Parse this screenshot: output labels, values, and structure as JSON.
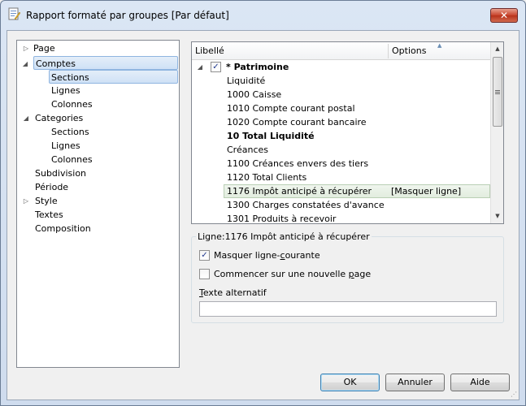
{
  "window": {
    "title": "Rapport formaté par groupes [Par défaut]",
    "close_glyph": "✕"
  },
  "tree": {
    "items": [
      {
        "label": "Page",
        "arrow": "▷"
      },
      {
        "label": "Comptes",
        "arrow": "◢"
      },
      {
        "label": "Sections",
        "arrow": ""
      },
      {
        "label": "Lignes",
        "arrow": ""
      },
      {
        "label": "Colonnes",
        "arrow": ""
      },
      {
        "label": "Categories",
        "arrow": "◢"
      },
      {
        "label": "Sections",
        "arrow": ""
      },
      {
        "label": "Lignes",
        "arrow": ""
      },
      {
        "label": "Colonnes",
        "arrow": ""
      },
      {
        "label": "Subdivision",
        "arrow": ""
      },
      {
        "label": "Période",
        "arrow": ""
      },
      {
        "label": "Style",
        "arrow": "▷"
      },
      {
        "label": "Textes",
        "arrow": ""
      },
      {
        "label": "Composition",
        "arrow": ""
      }
    ]
  },
  "list": {
    "col_libelle": "Libellé",
    "col_options": "Options",
    "sort_glyph": "▲",
    "root_arrow": "◢",
    "rows": [
      {
        "label": "* Patrimoine",
        "options": "",
        "checked": "✓"
      },
      {
        "label": "Liquidité",
        "options": ""
      },
      {
        "label": "1000 Caisse",
        "options": ""
      },
      {
        "label": "1010 Compte courant postal",
        "options": ""
      },
      {
        "label": "1020 Compte courant bancaire",
        "options": ""
      },
      {
        "label": "10 Total Liquidité",
        "options": ""
      },
      {
        "label": "Créances",
        "options": ""
      },
      {
        "label": "1100 Créances envers des tiers",
        "options": ""
      },
      {
        "label": "1120 Total Clients",
        "options": ""
      },
      {
        "label": "1176 Impôt anticipé à récupérer",
        "options": "[Masquer ligne]"
      },
      {
        "label": "1300 Charges constatées d'avance",
        "options": ""
      },
      {
        "label": "1301 Produits à recevoir",
        "options": ""
      }
    ],
    "scroll_up": "▲",
    "scroll_down": "▼"
  },
  "line_group": {
    "legend": "Ligne:1176 Impôt anticipé à récupérer",
    "hide_line": {
      "before": "Masquer ligne-",
      "underlined": "c",
      "after": "ourante",
      "checked": "✓"
    },
    "new_page": {
      "before": "Commencer sur une nouvelle ",
      "underlined": "p",
      "after": "age",
      "checked": ""
    },
    "alt_text": {
      "underlined": "T",
      "after": "exte alternatif",
      "value": ""
    }
  },
  "buttons": {
    "ok": "OK",
    "cancel": "Annuler",
    "help": "Aide"
  }
}
